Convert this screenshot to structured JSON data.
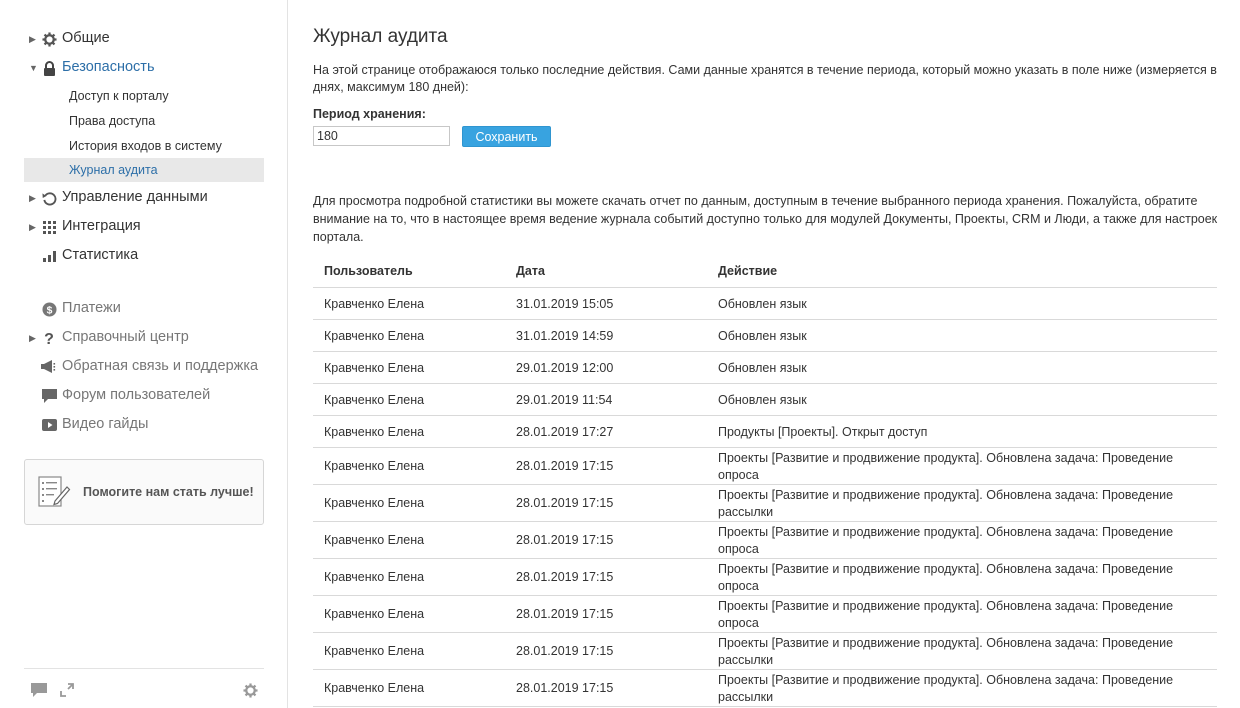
{
  "sidebar": {
    "items": [
      {
        "label": "Общие",
        "icon": "gear-icon"
      },
      {
        "label": "Безопасность",
        "icon": "lock-icon"
      },
      {
        "label": "Управление данными",
        "icon": "restore-icon"
      },
      {
        "label": "Интеграция",
        "icon": "grid-icon"
      },
      {
        "label": "Статистика",
        "icon": "bar-chart-icon"
      }
    ],
    "security_subitems": [
      {
        "label": "Доступ к порталу"
      },
      {
        "label": "Права доступа"
      },
      {
        "label": "История входов в систему"
      },
      {
        "label": "Журнал аудита"
      }
    ],
    "help_items": [
      {
        "label": "Платежи",
        "icon": "dollar-icon"
      },
      {
        "label": "Справочный центр",
        "icon": "question-icon"
      },
      {
        "label": "Обратная связь и поддержка",
        "icon": "megaphone-icon"
      },
      {
        "label": "Форум пользователей",
        "icon": "chat-icon"
      },
      {
        "label": "Видео гайды",
        "icon": "play-icon"
      }
    ],
    "promo_text": "Помогите нам стать лучше!"
  },
  "main": {
    "title": "Журнал аудита",
    "description": "На этой странице отображаюся только последние действия. Сами данные хранятся в течение периода, который можно указать в поле ниже (измеряется в днях, максимум 180 дней):",
    "period_label": "Период хранения:",
    "period_value": "180",
    "save_label": "Сохранить",
    "stats_text": "Для просмотра подробной статистики вы можете скачать отчет по данным, доступным в течение выбранного периода хранения. Пожалуйста, обратите внимание на то, что в настоящее время ведение журнала событий доступно только для модулей Документы, Проекты, CRM и Люди, а также для настроек портала.",
    "table": {
      "headers": {
        "user": "Пользователь",
        "date": "Дата",
        "action": "Действие"
      },
      "rows": [
        {
          "user": "Кравченко Елена",
          "date": "31.01.2019 15:05",
          "action": "Обновлен язык"
        },
        {
          "user": "Кравченко Елена",
          "date": "31.01.2019 14:59",
          "action": "Обновлен язык"
        },
        {
          "user": "Кравченко Елена",
          "date": "29.01.2019 12:00",
          "action": "Обновлен язык"
        },
        {
          "user": "Кравченко Елена",
          "date": "29.01.2019 11:54",
          "action": "Обновлен язык"
        },
        {
          "user": "Кравченко Елена",
          "date": "28.01.2019 17:27",
          "action": "Продукты [Проекты]. Открыт доступ"
        },
        {
          "user": "Кравченко Елена",
          "date": "28.01.2019 17:15",
          "action": "Проекты [Развитие и продвижение продукта]. Обновлена задача: Проведение опроса"
        },
        {
          "user": "Кравченко Елена",
          "date": "28.01.2019 17:15",
          "action": "Проекты [Развитие и продвижение продукта]. Обновлена задача: Проведение рассылки"
        },
        {
          "user": "Кравченко Елена",
          "date": "28.01.2019 17:15",
          "action": "Проекты [Развитие и продвижение продукта]. Обновлена задача: Проведение опроса"
        },
        {
          "user": "Кравченко Елена",
          "date": "28.01.2019 17:15",
          "action": "Проекты [Развитие и продвижение продукта]. Обновлена задача: Проведение опроса"
        },
        {
          "user": "Кравченко Елена",
          "date": "28.01.2019 17:15",
          "action": "Проекты [Развитие и продвижение продукта]. Обновлена задача: Проведение опроса"
        },
        {
          "user": "Кравченко Елена",
          "date": "28.01.2019 17:15",
          "action": "Проекты [Развитие и продвижение продукта]. Обновлена задача: Проведение рассылки"
        },
        {
          "user": "Кравченко Елена",
          "date": "28.01.2019 17:15",
          "action": "Проекты [Развитие и продвижение продукта]. Обновлена задача: Проведение рассылки"
        }
      ]
    }
  },
  "colors": {
    "accent": "#2d6fa8",
    "button": "#38a3e0",
    "selected_bg": "#e8e8e8"
  }
}
